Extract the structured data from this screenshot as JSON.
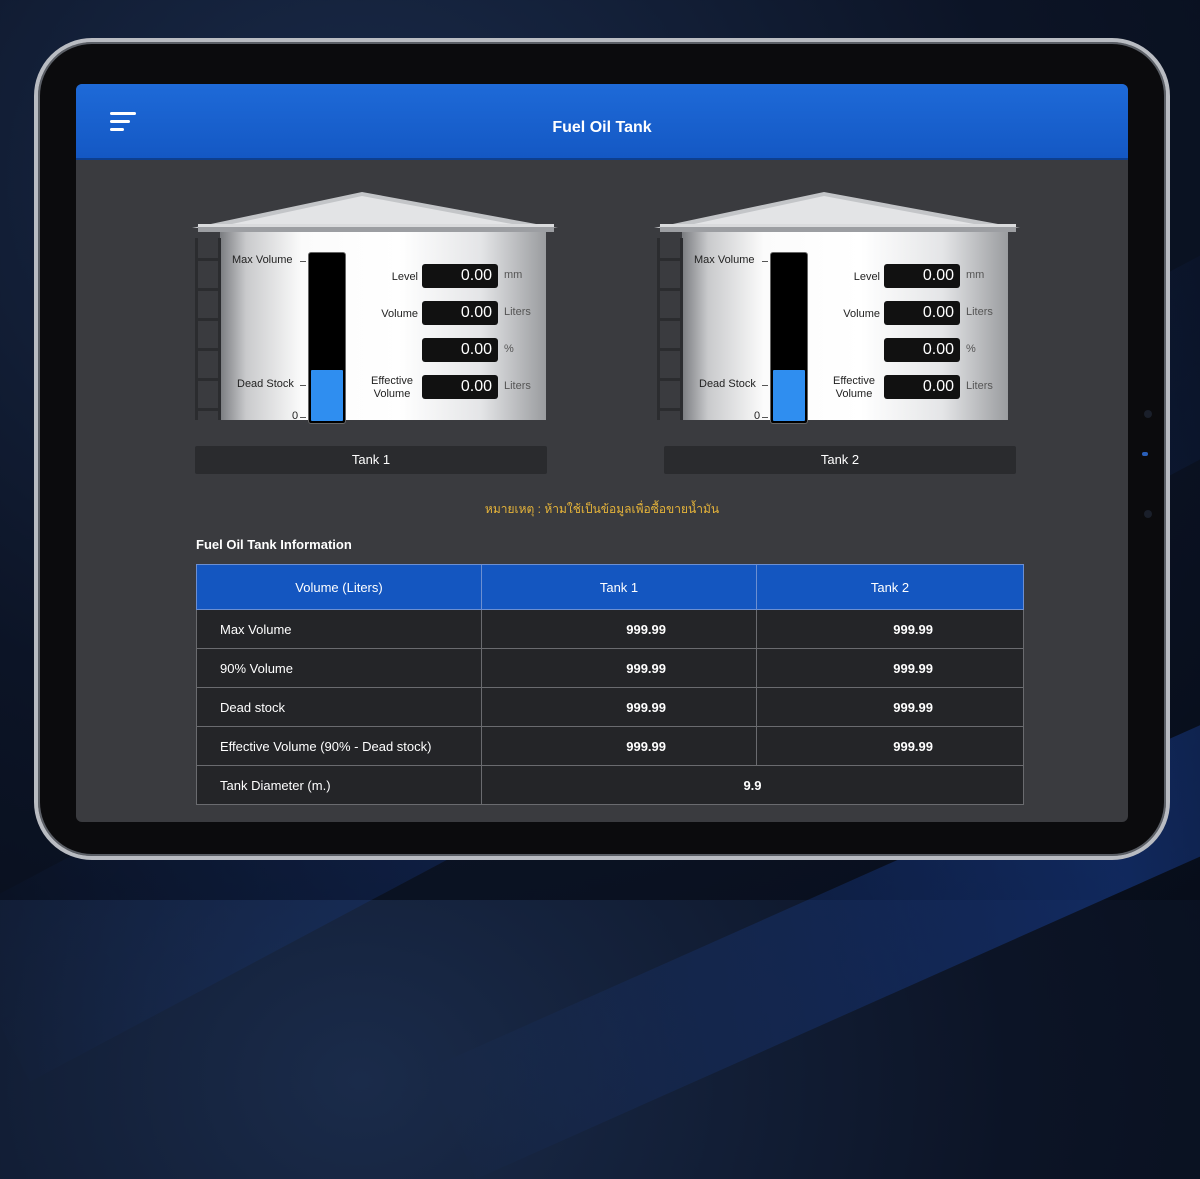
{
  "app": {
    "title": "Fuel Oil Tank"
  },
  "tanks": [
    {
      "name": "Tank 1",
      "gauge_labels": {
        "max": "Max Volume",
        "dead": "Dead Stock",
        "zero": "0"
      },
      "fill_fraction": 0.3,
      "fields": [
        {
          "label": "Level",
          "value": "0.00",
          "unit": "mm"
        },
        {
          "label": "Volume",
          "value": "0.00",
          "unit": "Liters"
        },
        {
          "label": "",
          "value": "0.00",
          "unit": "%"
        },
        {
          "label": "Effective Volume",
          "value": "0.00",
          "unit": "Liters"
        }
      ]
    },
    {
      "name": "Tank 2",
      "gauge_labels": {
        "max": "Max Volume",
        "dead": "Dead Stock",
        "zero": "0"
      },
      "fill_fraction": 0.3,
      "fields": [
        {
          "label": "Level",
          "value": "0.00",
          "unit": "mm"
        },
        {
          "label": "Volume",
          "value": "0.00",
          "unit": "Liters"
        },
        {
          "label": "",
          "value": "0.00",
          "unit": "%"
        },
        {
          "label": "Effective Volume",
          "value": "0.00",
          "unit": "Liters"
        }
      ]
    }
  ],
  "note": "หมายเหตุ : ห้ามใช้เป็นข้อมูลเพื่อซื้อขายน้ำมัน",
  "info": {
    "title": "Fuel Oil Tank Information",
    "headers": [
      "Volume (Liters)",
      "Tank 1",
      "Tank 2"
    ],
    "rows": [
      {
        "label": "Max Volume",
        "t1": "999.99",
        "t2": "999.99"
      },
      {
        "label": "90% Volume",
        "t1": "999.99",
        "t2": "999.99"
      },
      {
        "label": "Dead stock",
        "t1": "999.99",
        "t2": "999.99"
      },
      {
        "label": "Effective Volume (90% - Dead stock)",
        "t1": "999.99",
        "t2": "999.99"
      }
    ],
    "diameter": {
      "label": "Tank Diameter (m.)",
      "value": "9.9"
    }
  },
  "colors": {
    "accent": "#1e6ad8",
    "fill": "#2f8ef0",
    "note": "#e6b43a"
  }
}
